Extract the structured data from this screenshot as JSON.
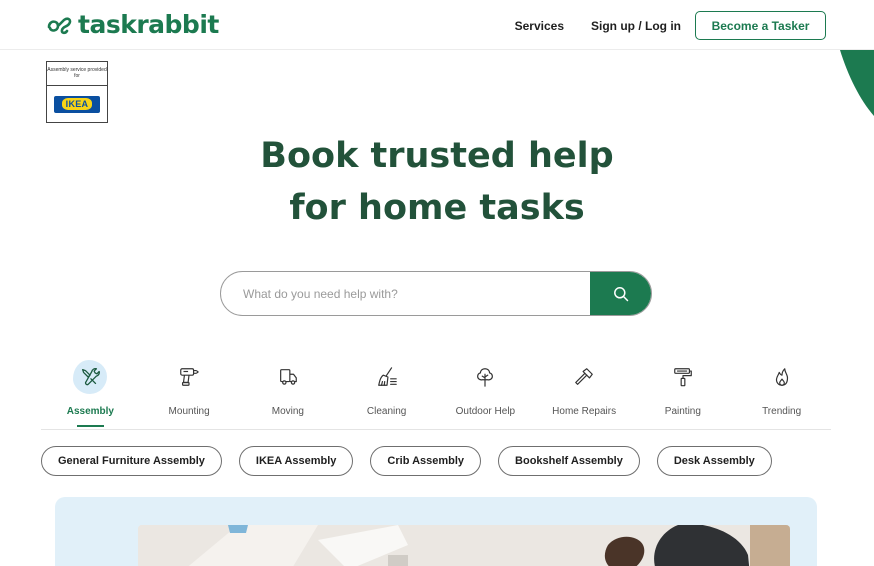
{
  "header": {
    "logo_text": "taskrabbit",
    "nav": {
      "services": "Services",
      "signup_login": "Sign up / Log in",
      "become_tasker": "Become a Tasker"
    }
  },
  "ikea_badge": {
    "caption": "Assembly service provided for",
    "brand": "IKEA"
  },
  "hero": {
    "title_line1": "Book trusted help",
    "title_line2": "for home tasks"
  },
  "search": {
    "placeholder": "What do you need help with?",
    "icon": "search-icon"
  },
  "categories": [
    {
      "label": "Assembly",
      "icon": "tools-icon",
      "active": true
    },
    {
      "label": "Mounting",
      "icon": "drill-icon",
      "active": false
    },
    {
      "label": "Moving",
      "icon": "truck-icon",
      "active": false
    },
    {
      "label": "Cleaning",
      "icon": "broom-icon",
      "active": false
    },
    {
      "label": "Outdoor Help",
      "icon": "tree-icon",
      "active": false
    },
    {
      "label": "Home Repairs",
      "icon": "hammer-icon",
      "active": false
    },
    {
      "label": "Painting",
      "icon": "paint-roller-icon",
      "active": false
    },
    {
      "label": "Trending",
      "icon": "flame-icon",
      "active": false
    }
  ],
  "chips": [
    "General Furniture Assembly",
    "IKEA Assembly",
    "Crib Assembly",
    "Bookshelf Assembly",
    "Desk Assembly"
  ],
  "colors": {
    "brand_green": "#1c7a50",
    "hero_title": "#22523a",
    "active_bg": "#d7ebf8",
    "promo_bg": "#e1f0f9"
  }
}
